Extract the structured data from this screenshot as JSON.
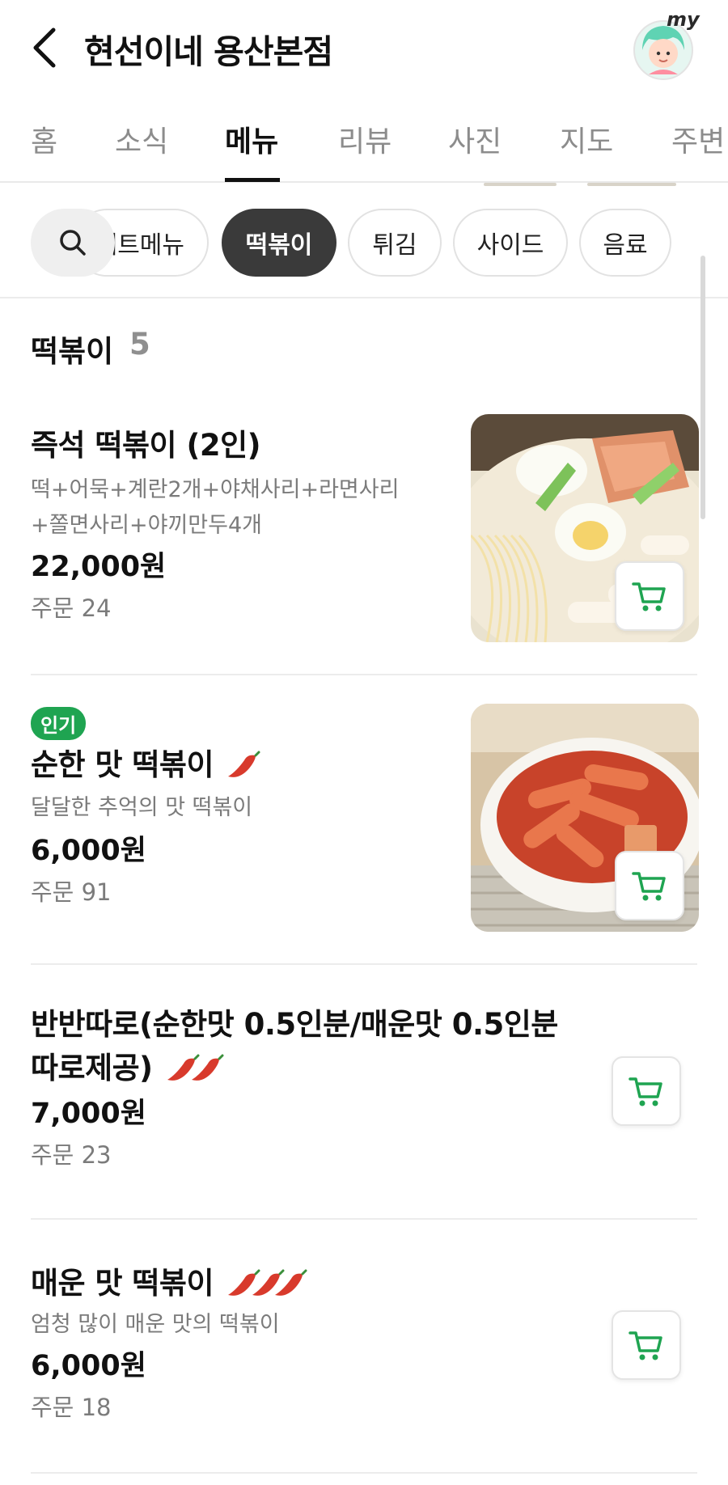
{
  "header": {
    "title": "현선이네 용산본점",
    "avatar_label": "my"
  },
  "tabs": [
    "홈",
    "소식",
    "메뉴",
    "리뷰",
    "사진",
    "지도",
    "주변"
  ],
  "active_tab": "메뉴",
  "chips": [
    "세트메뉴",
    "떡볶이",
    "튀김",
    "사이드",
    "음료"
  ],
  "active_chip": "떡볶이",
  "section": {
    "title": "떡볶이",
    "count": "5"
  },
  "items": [
    {
      "badge": "",
      "name": "즉석 떡볶이 (2인)",
      "desc": [
        "떡+어묵+계란2개+야채사리+라면사리",
        "+쫄면사리+야끼만두4개"
      ],
      "price": "22,000원",
      "orders": "주문 24",
      "spice": 0,
      "has_photo": true
    },
    {
      "badge": "인기",
      "name": "순한 맛 떡볶이",
      "desc": [
        "달달한 추억의 맛 떡볶이"
      ],
      "price": "6,000원",
      "orders": "주문 91",
      "spice": 1,
      "has_photo": true
    },
    {
      "badge": "",
      "name": "반반따로(순한맛 0.5인분/매운맛 0.5인분",
      "name_line2": "따로제공)",
      "desc": [],
      "price": "7,000원",
      "orders": "주문 23",
      "spice": 2,
      "has_photo": false
    },
    {
      "badge": "",
      "name": "매운 맛 떡볶이",
      "desc": [
        "엄청 많이 매운 맛의 떡볶이"
      ],
      "price": "6,000원",
      "orders": "주문 18",
      "spice": 3,
      "has_photo": false
    }
  ],
  "colors": {
    "accent_green": "#1fa451",
    "chip_active": "#3a3a3a",
    "pepper_red": "#d83a2c"
  },
  "icons": {
    "back": "chevron-left-icon",
    "search": "search-icon",
    "cart": "cart-icon",
    "spice": "chili-pepper-icon"
  }
}
